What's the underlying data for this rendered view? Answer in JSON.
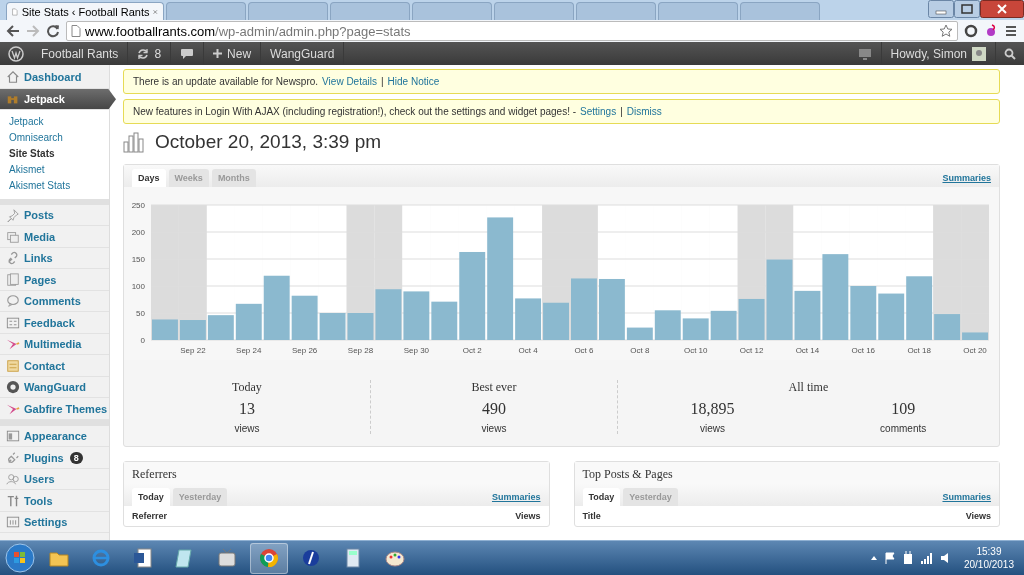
{
  "browser": {
    "tabs": [
      {
        "title": "Site Stats ‹ Football Rants",
        "selected": true
      },
      {
        "selected": false
      },
      {
        "selected": false
      },
      {
        "selected": false
      },
      {
        "selected": false
      },
      {
        "selected": false
      },
      {
        "selected": false
      },
      {
        "selected": false
      },
      {
        "selected": false
      }
    ],
    "address": {
      "host": "www.footballrants.com",
      "path": "/wp-admin/admin.php?page=stats"
    }
  },
  "admin_bar": {
    "site_name": "Football Rants",
    "updates_count": "8",
    "new_label": "New",
    "plugin_link": "WangGuard",
    "greeting": "Howdy, Simon"
  },
  "sidebar": {
    "items": [
      {
        "label": "Dashboard",
        "selected": false
      },
      {
        "label": "Jetpack",
        "selected": true,
        "children": [
          {
            "label": "Jetpack",
            "selected": false
          },
          {
            "label": "Omnisearch",
            "selected": false
          },
          {
            "label": "Site Stats",
            "selected": true
          },
          {
            "label": "Akismet",
            "selected": false
          },
          {
            "label": "Akismet Stats",
            "selected": false
          }
        ]
      },
      {
        "label": "Posts",
        "selected": false,
        "group_start": true
      },
      {
        "label": "Media",
        "selected": false
      },
      {
        "label": "Links",
        "selected": false
      },
      {
        "label": "Pages",
        "selected": false
      },
      {
        "label": "Comments",
        "selected": false
      },
      {
        "label": "Feedback",
        "selected": false
      },
      {
        "label": "Multimedia",
        "selected": false
      },
      {
        "label": "Contact",
        "selected": false
      },
      {
        "label": "WangGuard",
        "selected": false
      },
      {
        "label": "Gabfire Themes",
        "selected": false
      },
      {
        "label": "Appearance",
        "selected": false,
        "group_start": true
      },
      {
        "label": "Plugins",
        "selected": false,
        "badge": "8"
      },
      {
        "label": "Users",
        "selected": false
      },
      {
        "label": "Tools",
        "selected": false
      },
      {
        "label": "Settings",
        "selected": false
      }
    ]
  },
  "notices": [
    {
      "text": "There is an update available for Newspro.",
      "links": [
        "View Details",
        "Hide Notice"
      ],
      "separator": "|"
    },
    {
      "text": "New features in Login With AJAX (including registration!), check out the settings and widget pages! -",
      "links": [
        "Settings",
        "Dismiss"
      ],
      "separator": "|"
    }
  ],
  "page_title": "October 20, 2013, 3:39 pm",
  "stats": {
    "tabs": [
      {
        "label": "Days",
        "selected": true
      },
      {
        "label": "Weeks",
        "selected": false
      },
      {
        "label": "Months",
        "selected": false
      }
    ],
    "summaries_link": "Summaries",
    "chart_data": {
      "type": "bar",
      "categories": [
        null,
        "Sep 22",
        null,
        "Sep 24",
        null,
        "Sep 26",
        null,
        "Sep 28",
        null,
        "Sep 30",
        null,
        "Oct 2",
        null,
        "Oct 4",
        null,
        "Oct 6",
        null,
        "Oct 8",
        null,
        "Oct 10",
        null,
        "Oct 12",
        null,
        "Oct 14",
        null,
        "Oct 16",
        null,
        "Oct 18",
        null,
        "Oct 20"
      ],
      "series": [
        {
          "color": "#8bb9cf",
          "values": [
            38,
            37,
            46,
            67,
            119,
            82,
            50,
            50,
            94,
            90,
            71,
            163,
            227,
            77,
            69,
            114,
            113,
            23,
            55,
            40,
            54,
            76,
            149,
            91,
            159,
            100,
            86,
            118,
            48,
            14
          ]
        }
      ],
      "ylim": [
        0,
        250
      ],
      "yticks": [
        0,
        50,
        100,
        150,
        200,
        250
      ],
      "grid": true
    },
    "weekend_shading": [
      true,
      true,
      false,
      false,
      false,
      false,
      false,
      true,
      true,
      false,
      false,
      false,
      false,
      false,
      true,
      true,
      false,
      false,
      false,
      false,
      false,
      true,
      true,
      false,
      false,
      false,
      false,
      false,
      true,
      true
    ],
    "summary": [
      {
        "heading": "Today",
        "items": [
          {
            "value": "13",
            "label": "views"
          }
        ]
      },
      {
        "heading": "Best ever",
        "items": [
          {
            "value": "490",
            "label": "views"
          }
        ]
      },
      {
        "heading": "All time",
        "items": [
          {
            "value": "18,895",
            "label": "views"
          },
          {
            "value": "109",
            "label": "comments"
          }
        ]
      }
    ]
  },
  "panels": [
    {
      "title": "Referrers",
      "tabs": [
        {
          "label": "Today",
          "selected": true
        },
        {
          "label": "Yesterday",
          "selected": false
        }
      ],
      "summaries_link": "Summaries",
      "columns": [
        "Referrer",
        "Views"
      ]
    },
    {
      "title": "Top Posts & Pages",
      "tabs": [
        {
          "label": "Today",
          "selected": true
        },
        {
          "label": "Yesterday",
          "selected": false
        }
      ],
      "summaries_link": "Summaries",
      "columns": [
        "Title",
        "Views"
      ]
    }
  ],
  "taskbar": {
    "time": "15:39",
    "date": "20/10/2013"
  }
}
